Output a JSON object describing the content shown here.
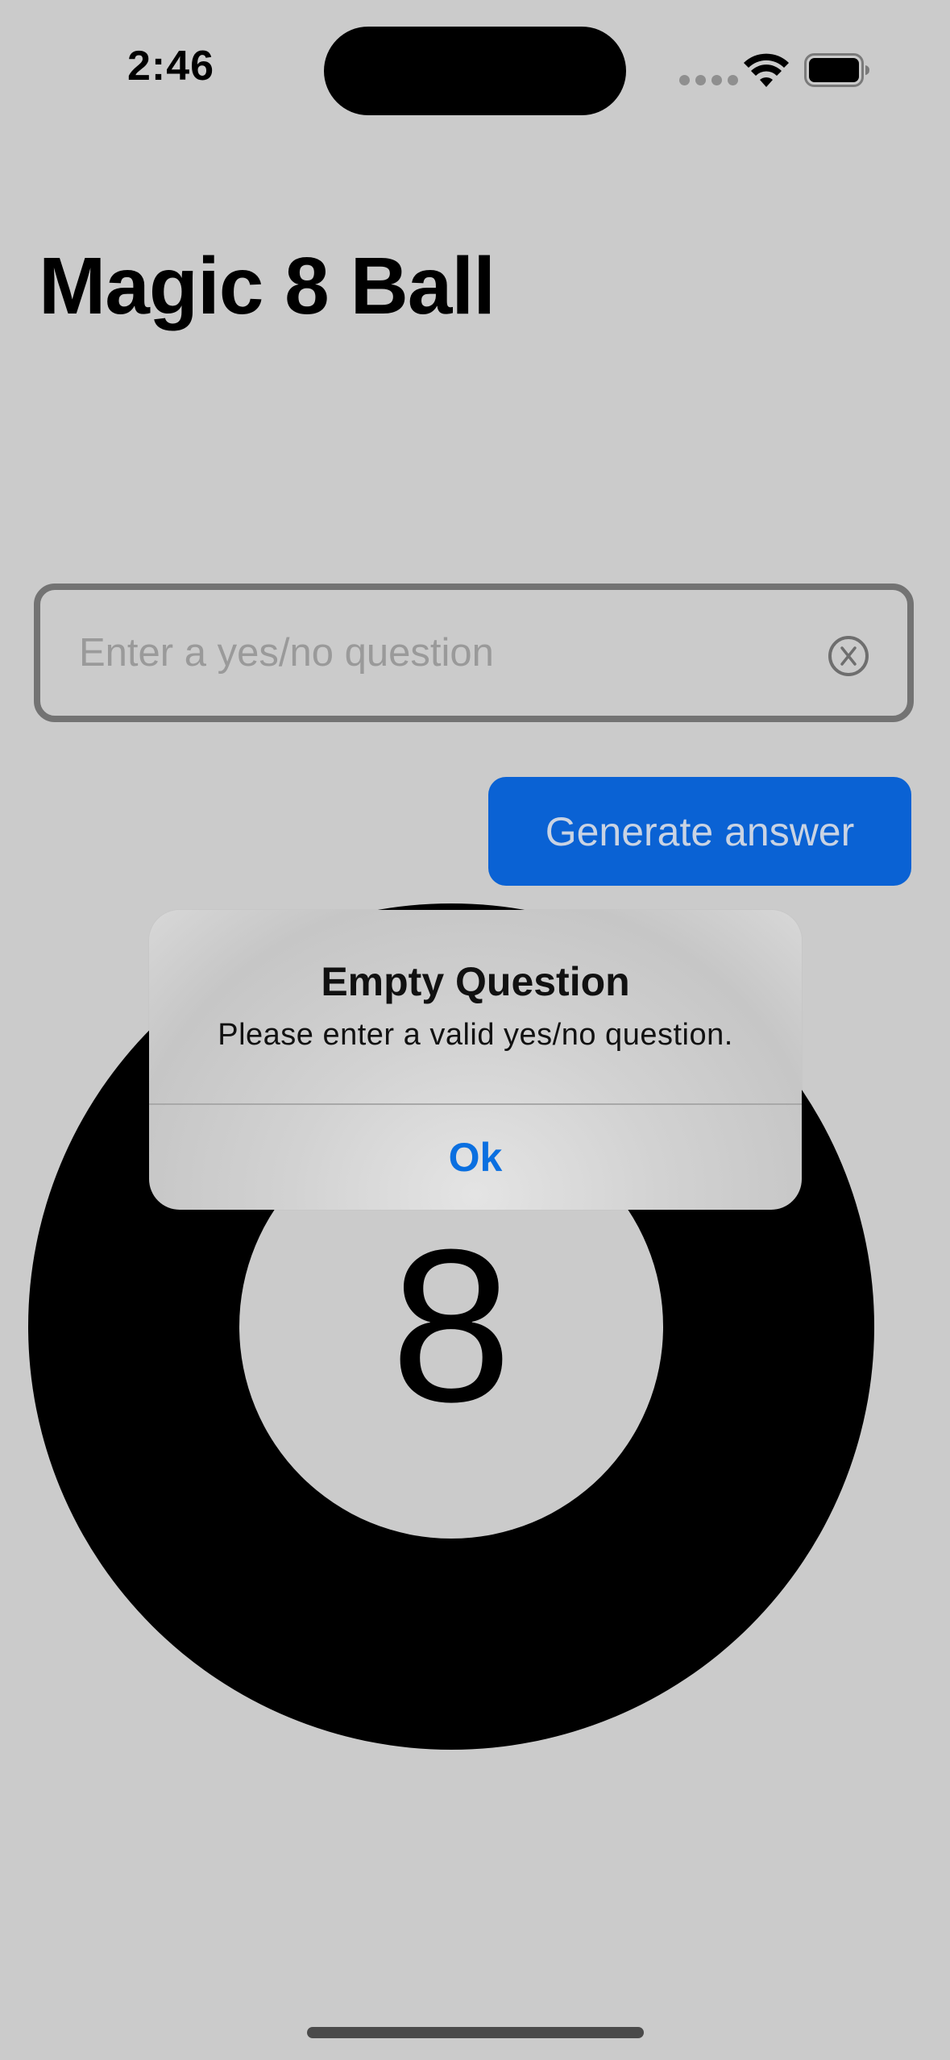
{
  "status_bar": {
    "time": "2:46",
    "icons": [
      "signal-dots-icon",
      "wifi-icon",
      "battery-icon"
    ]
  },
  "page": {
    "title": "Magic 8 Ball"
  },
  "question_field": {
    "value": "",
    "placeholder": "Enter a yes/no question",
    "clear_icon": "clear-circle-x-icon"
  },
  "generate_button": {
    "label": "Generate answer",
    "color": "#0a62d4"
  },
  "eight_ball": {
    "label": "8"
  },
  "alert": {
    "title": "Empty Question",
    "message": "Please enter a valid yes/no question.",
    "ok_label": "Ok",
    "ok_color": "#0a6fe0"
  },
  "colors": {
    "background": "#cbcbcb",
    "ball": "#000000"
  }
}
